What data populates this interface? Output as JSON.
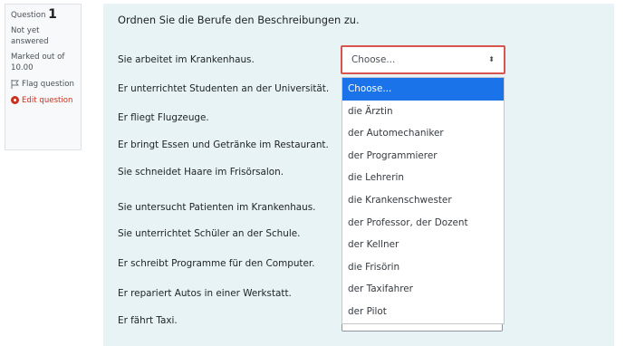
{
  "info": {
    "question_label": "Question",
    "question_number": "1",
    "status": "Not yet answered",
    "marks": "Marked out of 10.00",
    "flag_label": "Flag question",
    "edit_label": "Edit question"
  },
  "question": {
    "text": "Ordnen Sie die Berufe den Beschreibungen zu.",
    "descriptions": [
      "Sie arbeitet im Krankenhaus.",
      "Er unterrichtet Studenten an der Universität.",
      "Er fliegt Flugzeuge.",
      "Er bringt Essen und Getränke im Restaurant.",
      "Sie schneidet Haare im Frisörsalon.",
      "Sie untersucht Patienten im Krankenhaus.",
      "Sie unterrichtet Schüler an der Schule.",
      "Er schreibt Programme für den Computer.",
      "Er repariert Autos in einer Werkstatt.",
      "Er fährt Taxi."
    ],
    "select_value": "Choose...",
    "select_arrow": "⬍",
    "options": [
      "Choose...",
      "die Ärztin",
      "der Automechaniker",
      "der Programmierer",
      "die Lehrerin",
      "die Krankenschwester",
      "der Professor, der Dozent",
      "der Kellner",
      "die Frisörin",
      "der Taxifahrer",
      "der Pilot"
    ]
  },
  "colors": {
    "panel_bg": "#e7f3f5",
    "highlight": "#1a73e8",
    "focus_border": "#d9534f",
    "edit_red": "#ca3120"
  }
}
